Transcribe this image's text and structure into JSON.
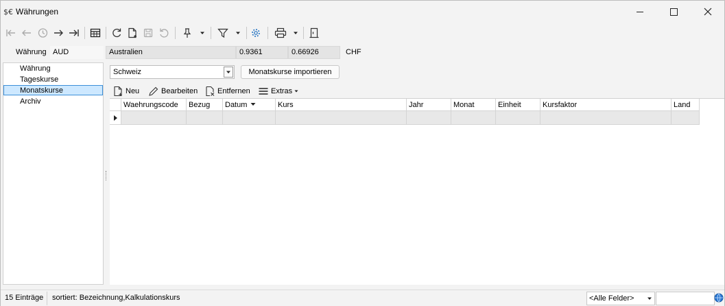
{
  "window": {
    "title": "Währungen",
    "icon": "currency-icon",
    "controls": [
      "minimize",
      "maximize",
      "close"
    ]
  },
  "toolbar": {
    "buttons": [
      "first-record",
      "previous-record",
      "history",
      "next-record",
      "last-record",
      "table-view",
      "refresh",
      "new-document",
      "save",
      "undo",
      "pin",
      "filter",
      "settings",
      "print",
      "exit"
    ]
  },
  "header": {
    "currency_label": "Währung",
    "currency_code": "AUD",
    "currency_name": "Australien",
    "rate1": "0.9361",
    "rate2": "0.66926",
    "base_currency": "CHF"
  },
  "sidebar": {
    "items": [
      {
        "label": "Währung",
        "selected": false
      },
      {
        "label": "Tageskurse",
        "selected": false
      },
      {
        "label": "Monatskurse",
        "selected": true
      },
      {
        "label": "Archiv",
        "selected": false
      }
    ]
  },
  "main": {
    "country_select": "Schweiz",
    "import_button": "Monatskurse importieren",
    "subtoolbar": {
      "new": "Neu",
      "edit": "Bearbeiten",
      "remove": "Entfernen",
      "extras": "Extras"
    },
    "grid": {
      "columns": [
        "Waehrungscode",
        "Bezug",
        "Datum",
        "Kurs",
        "Jahr",
        "Monat",
        "Einheit",
        "Kursfaktor",
        "Land"
      ],
      "sorted_column": "Datum",
      "rows": [
        [
          "",
          "",
          "",
          "",
          "",
          "",
          "",
          "",
          ""
        ]
      ]
    }
  },
  "status": {
    "count": "15 Einträge",
    "sort": "sortiert: Bezeichnung,Kalkulationskurs",
    "field_filter": "<Alle Felder>",
    "search_value": ""
  }
}
